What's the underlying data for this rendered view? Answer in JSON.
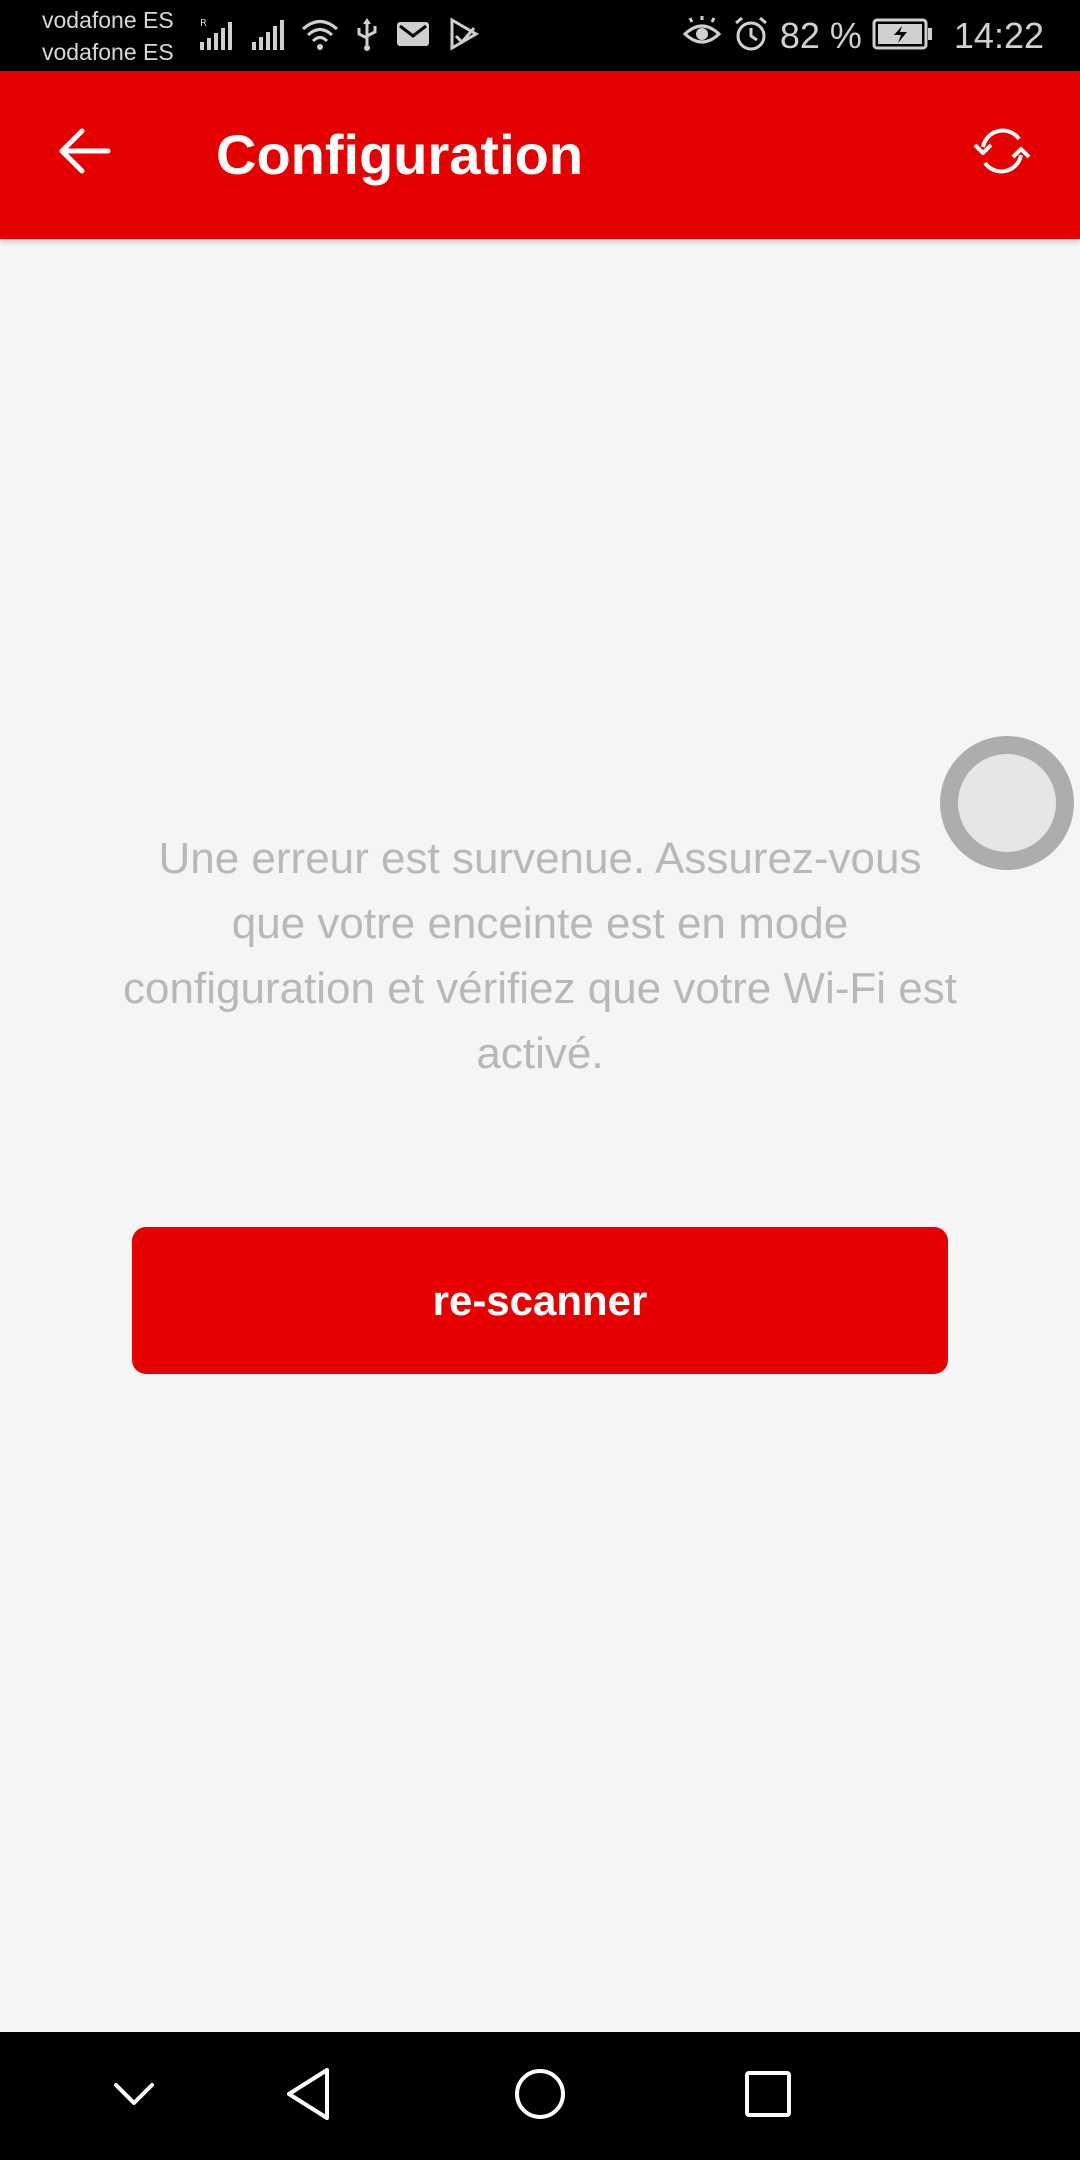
{
  "status_bar": {
    "carrier_1": "vodafone ES",
    "carrier_2": "vodafone ES",
    "battery_percent": "82 %",
    "time": "14:22",
    "icons": [
      "signal-roaming-icon",
      "signal-icon",
      "wifi-icon",
      "usb-icon",
      "notification-icon",
      "play-store-icon",
      "eye-comfort-icon",
      "alarm-icon",
      "battery-charging-icon"
    ]
  },
  "app_bar": {
    "title": "Configuration",
    "back_icon": "arrow-left-icon",
    "refresh_icon": "refresh-icon",
    "background_color": "#e60000"
  },
  "main": {
    "error_message": "Une erreur est survenue. Assurez-vous que votre enceinte est en mode configuration et vérifiez que votre Wi-Fi est activé.",
    "rescan_label": "re-scanner",
    "accent_color": "#e60000"
  },
  "nav_bar": {
    "buttons": [
      "chevron-down-icon",
      "back-triangle-icon",
      "home-circle-icon",
      "recents-square-icon"
    ]
  }
}
